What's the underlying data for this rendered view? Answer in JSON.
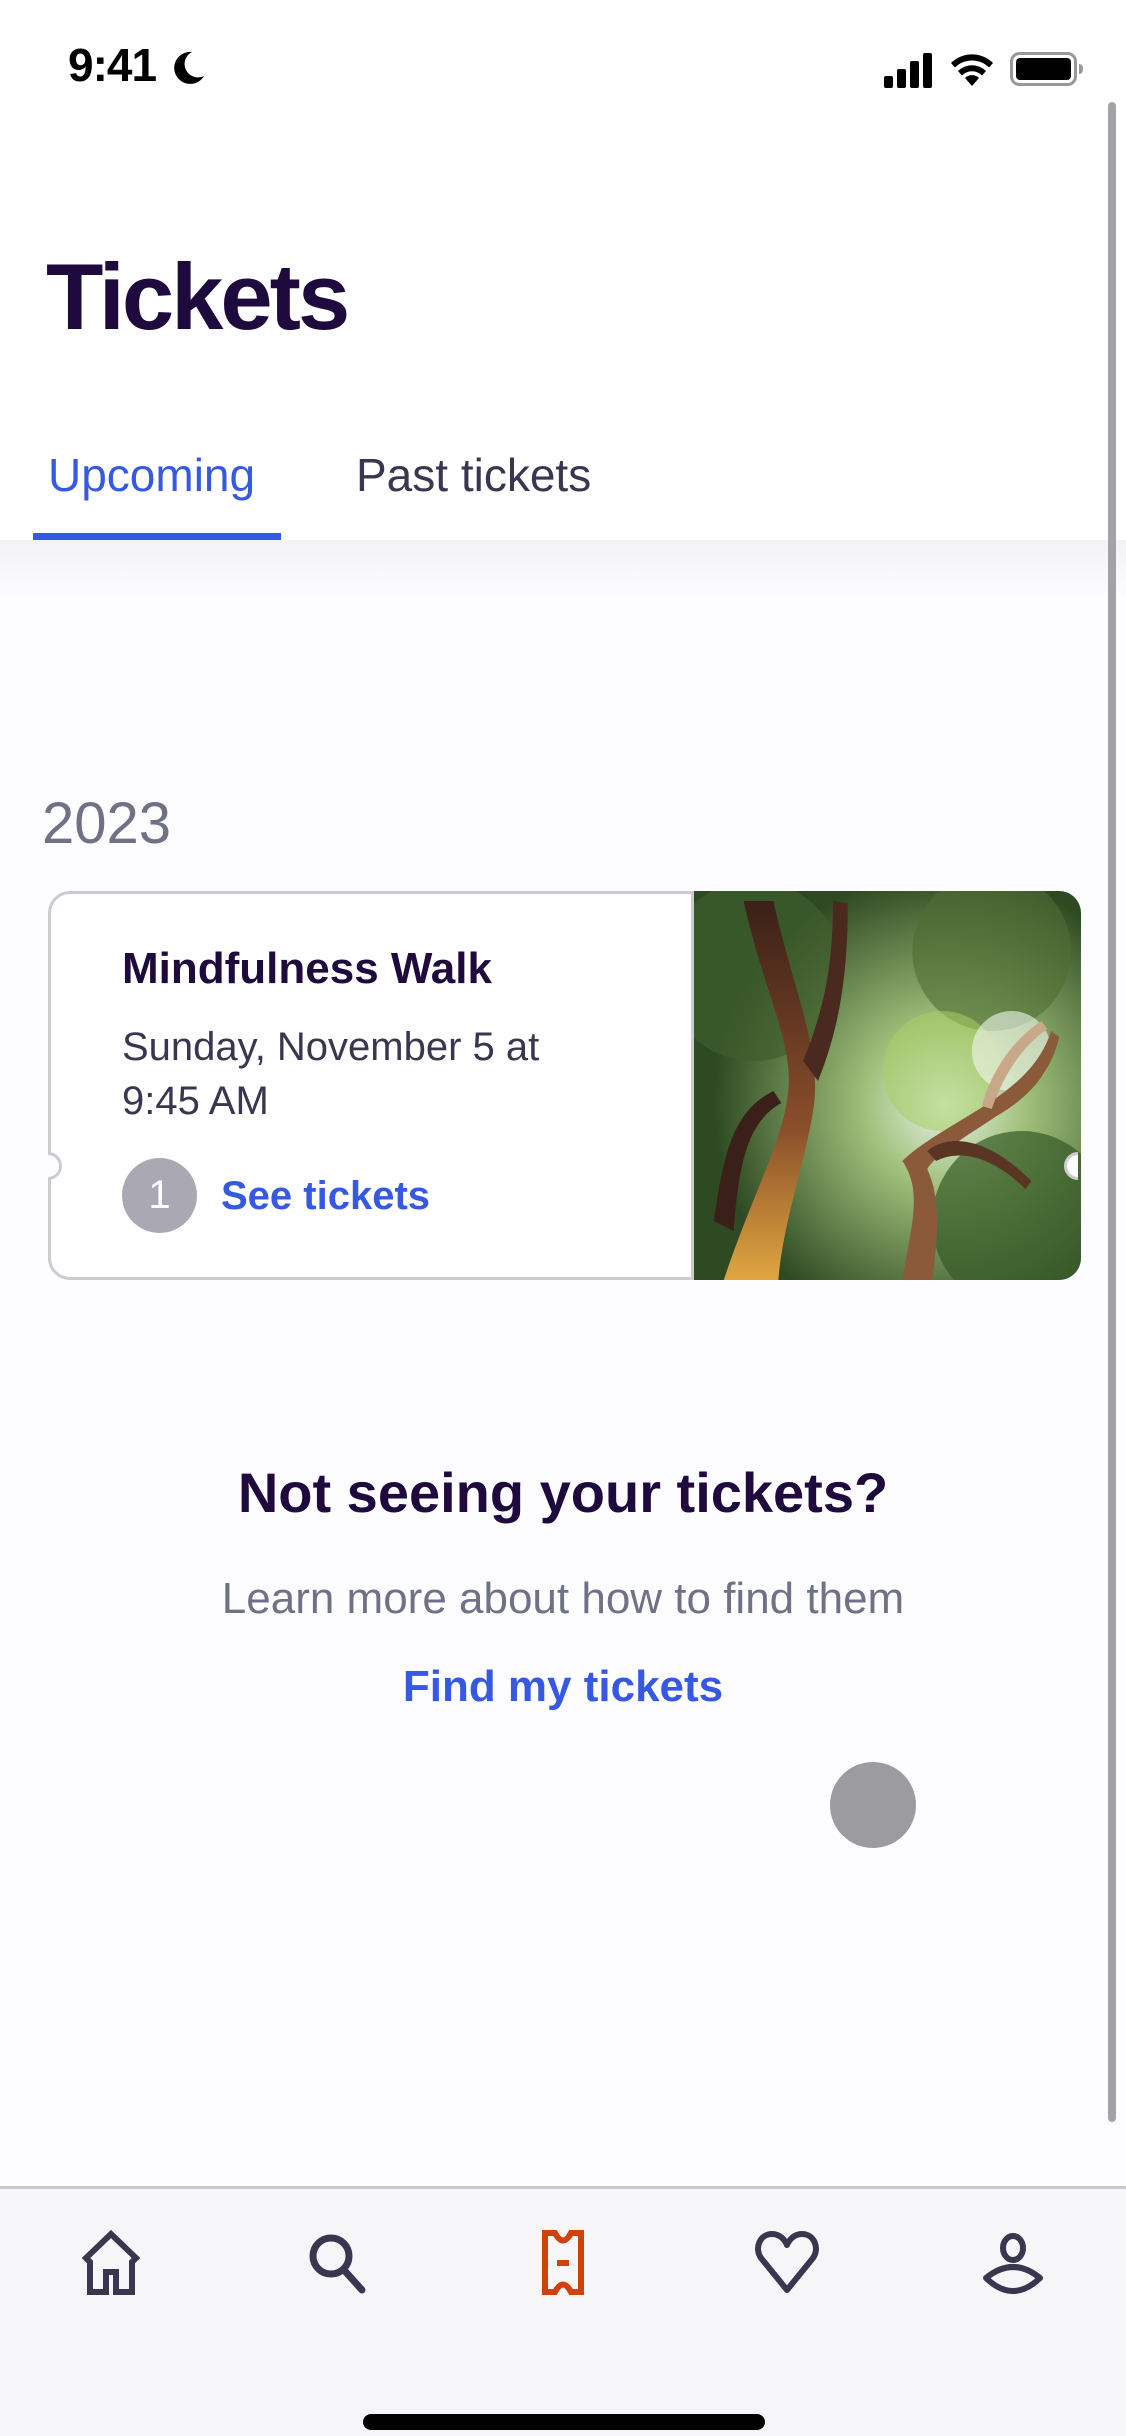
{
  "status_bar": {
    "time": "9:41",
    "icons": [
      "moon-icon",
      "signal-icon",
      "wifi-icon",
      "battery-icon"
    ]
  },
  "header": {
    "title": "Tickets",
    "tabs": [
      {
        "label": "Upcoming",
        "active": true
      },
      {
        "label": "Past tickets",
        "active": false
      }
    ]
  },
  "tickets": {
    "year": "2023",
    "events": [
      {
        "title": "Mindfulness Walk",
        "date": "Sunday, November 5 at 9:45 AM",
        "ticket_count": "1",
        "action_label": "See tickets",
        "image": "trees-canopy-photo"
      }
    ]
  },
  "help": {
    "title": "Not seeing your tickets?",
    "subtitle": "Learn more about how to find them",
    "link_label": "Find my tickets"
  },
  "tab_bar": {
    "items": [
      {
        "name": "home",
        "icon": "home-icon",
        "active": false
      },
      {
        "name": "search",
        "icon": "search-icon",
        "active": false
      },
      {
        "name": "tickets",
        "icon": "ticket-icon",
        "active": true
      },
      {
        "name": "likes",
        "icon": "heart-icon",
        "active": false
      },
      {
        "name": "profile",
        "icon": "profile-icon",
        "active": false
      }
    ]
  },
  "colors": {
    "brand_dark": "#1e0a3c",
    "accent_blue": "#3659e3",
    "active_tab_icon": "#d1410c",
    "inactive_icon": "#39364f",
    "muted_text": "#6f7287"
  }
}
